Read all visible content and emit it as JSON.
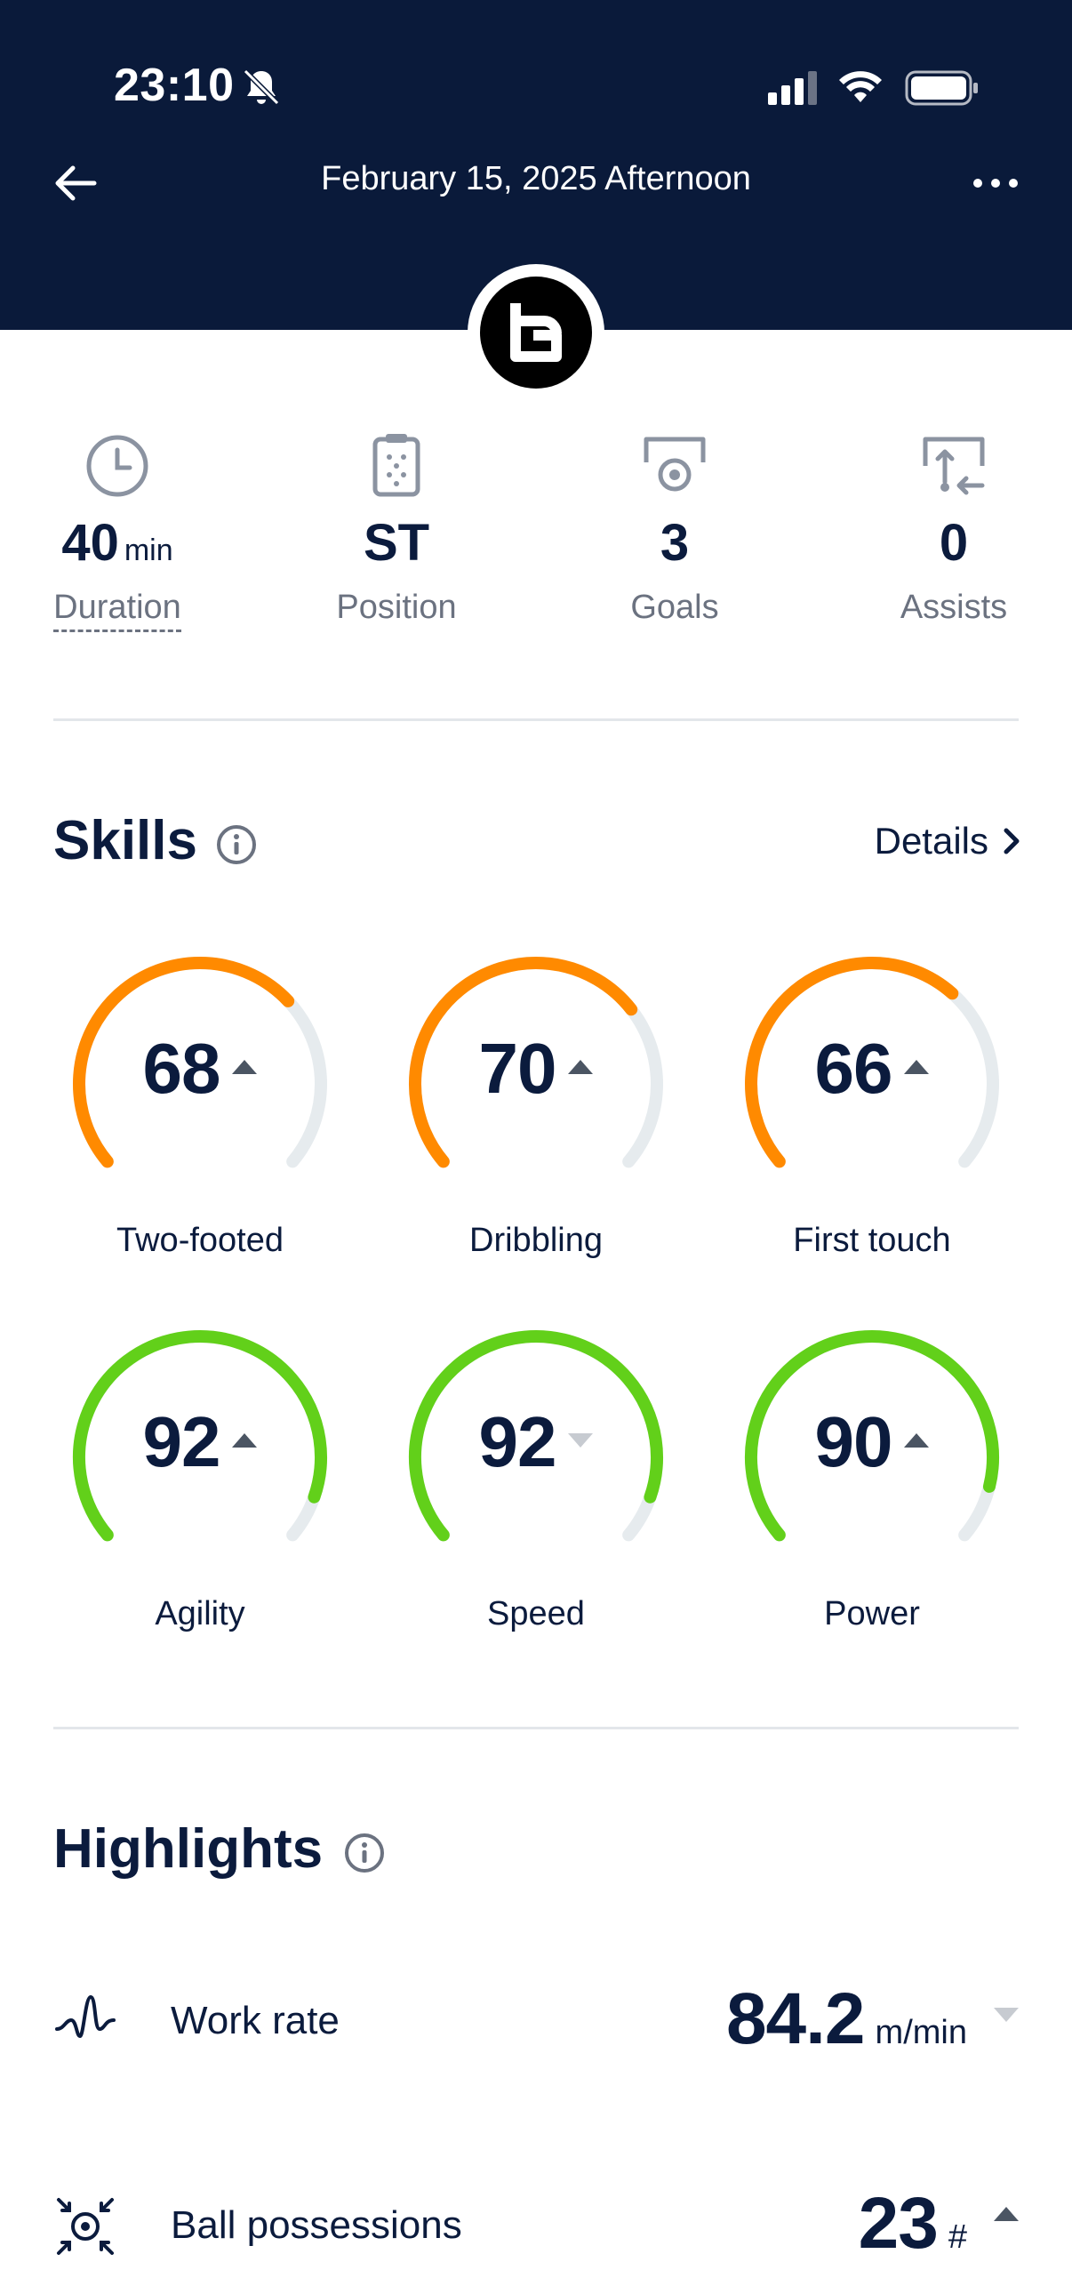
{
  "status_bar": {
    "time": "23:10"
  },
  "header": {
    "title": "February 15, 2025 Afternoon"
  },
  "stats": [
    {
      "value": "40",
      "unit": "min",
      "label": "Duration",
      "icon": "clock-icon"
    },
    {
      "value": "ST",
      "unit": "",
      "label": "Position",
      "icon": "clipboard-icon"
    },
    {
      "value": "3",
      "unit": "",
      "label": "Goals",
      "icon": "goal-icon"
    },
    {
      "value": "0",
      "unit": "",
      "label": "Assists",
      "icon": "assist-icon"
    }
  ],
  "skills": {
    "title": "Skills",
    "details_label": "Details",
    "items": [
      {
        "label": "Two-footed",
        "value": "68",
        "level": 68,
        "trend": "up",
        "color": "#ff8a00"
      },
      {
        "label": "Dribbling",
        "value": "70",
        "level": 70,
        "trend": "up",
        "color": "#ff8a00"
      },
      {
        "label": "First touch",
        "value": "66",
        "level": 66,
        "trend": "up",
        "color": "#ff8a00"
      },
      {
        "label": "Agility",
        "value": "92",
        "level": 92,
        "trend": "up",
        "color": "#62d01a"
      },
      {
        "label": "Speed",
        "value": "92",
        "level": 92,
        "trend": "down",
        "color": "#62d01a"
      },
      {
        "label": "Power",
        "value": "90",
        "level": 90,
        "trend": "up",
        "color": "#62d01a"
      }
    ]
  },
  "highlights": {
    "title": "Highlights",
    "items": [
      {
        "label": "Work rate",
        "value": "84.2",
        "unit": "m/min",
        "trend": "down",
        "icon": "work-rate-icon"
      },
      {
        "label": "Ball possessions",
        "value": "23",
        "unit": "#",
        "trend": "up",
        "icon": "ball-possession-icon"
      }
    ]
  },
  "colors": {
    "header_bg": "#0a1a3a",
    "orange": "#ff8a00",
    "green": "#62d01a",
    "track": "#e6ebee"
  }
}
